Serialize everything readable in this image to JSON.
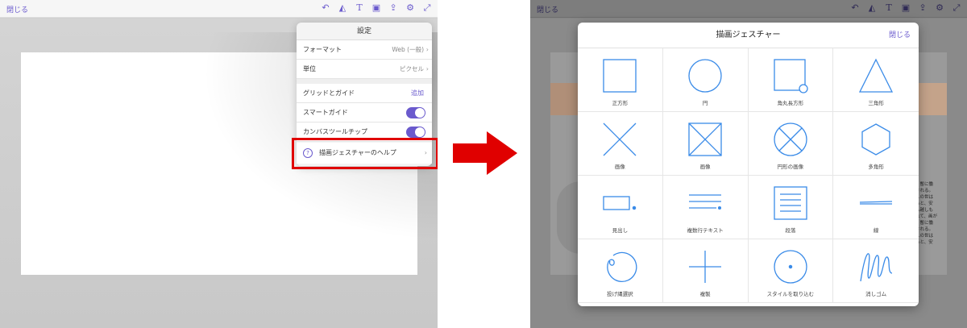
{
  "left": {
    "close_label": "閉じる",
    "toolbar_icons": [
      "undo-icon",
      "shape-icon",
      "text-icon",
      "image-icon",
      "share-icon",
      "gear-icon",
      "expand-icon"
    ],
    "settings": {
      "title": "設定",
      "format_label": "フォーマット",
      "format_value": "Web (一般)",
      "unit_label": "単位",
      "unit_value": "ピクセル",
      "grid_label": "グリッドとガイド",
      "grid_add": "追加",
      "smart_guide_label": "スマートガイド",
      "smart_guide_on": true,
      "canvas_tip_label": "カンバスツールチップ",
      "canvas_tip_on": true,
      "help_label": "描画ジェスチャーのヘルプ"
    }
  },
  "right": {
    "close_label": "閉じる",
    "side_text": [
      "、暫に働",
      "される。",
      "人の世は",
      "ると、安",
      "へ越しも",
      "れて、画が",
      "",
      "、暫に働",
      "される。",
      "人の世は",
      "ると、安"
    ],
    "modal": {
      "title": "描画ジェスチャー",
      "close_label": "閉じる",
      "gestures": [
        {
          "label": "正方形",
          "icon": "square-icon"
        },
        {
          "label": "円",
          "icon": "circle-icon"
        },
        {
          "label": "角丸長方形",
          "icon": "rounded-rect-icon"
        },
        {
          "label": "三角形",
          "icon": "triangle-icon"
        },
        {
          "label": "画像",
          "icon": "x-image-icon"
        },
        {
          "label": "画像",
          "icon": "boxed-x-image-icon"
        },
        {
          "label": "円形の画像",
          "icon": "circle-x-image-icon"
        },
        {
          "label": "多角形",
          "icon": "hexagon-icon"
        },
        {
          "label": "見出し",
          "icon": "heading-icon"
        },
        {
          "label": "複数行テキスト",
          "icon": "multiline-text-icon"
        },
        {
          "label": "段落",
          "icon": "paragraph-icon"
        },
        {
          "label": "線",
          "icon": "line-icon"
        },
        {
          "label": "投げ縄選択",
          "icon": "lasso-icon"
        },
        {
          "label": "複製",
          "icon": "plus-icon"
        },
        {
          "label": "スタイルを取り込む",
          "icon": "dot-circle-icon"
        },
        {
          "label": "消しゴム",
          "icon": "eraser-icon"
        }
      ]
    }
  },
  "colors": {
    "accent": "#6a5acd",
    "gesture_blue": "#3a8be8",
    "highlight": "#e00000"
  }
}
